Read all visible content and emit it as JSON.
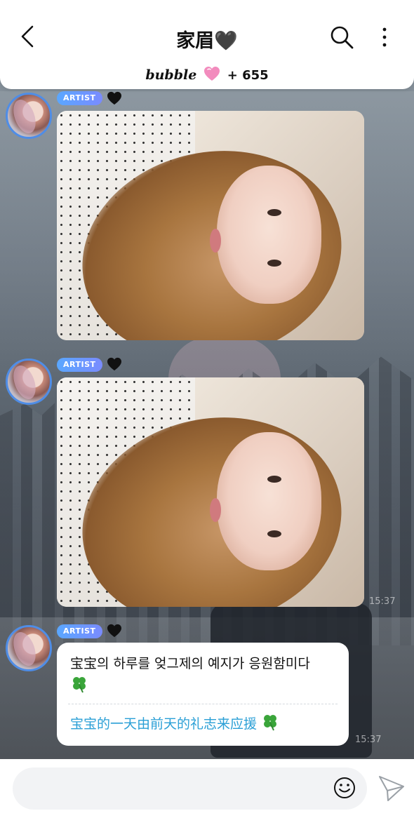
{
  "header": {
    "title": "家眉",
    "title_heart": "🖤",
    "brand": "bubble",
    "count": "+ 655",
    "icons": {
      "back": "chevron-left-icon",
      "search": "search-icon",
      "more": "more-vertical-icon",
      "pink_heart": "pink-heart-icon"
    }
  },
  "messages": [
    {
      "badge": "ARTIST",
      "heart": "black-heart-icon",
      "type": "image"
    },
    {
      "badge": "ARTIST",
      "heart": "black-heart-icon",
      "type": "image",
      "time": "15:37"
    },
    {
      "badge": "ARTIST",
      "heart": "black-heart-icon",
      "type": "text",
      "text_ko": "宝宝의 하루를 엊그제의 예지가 응원함미다",
      "text_zh": "宝宝的一天由前天的礼志来应援",
      "time": "15:37"
    }
  ],
  "input": {
    "placeholder": "",
    "icons": {
      "emoji": "smiley-icon",
      "send": "send-icon"
    }
  },
  "colors": {
    "accent_blue": "#4f8de6",
    "translation_text": "#2a9fd6",
    "badge_start": "#5aa7ff",
    "badge_end": "#7a8bff",
    "pink_heart": "#f28bbd"
  }
}
